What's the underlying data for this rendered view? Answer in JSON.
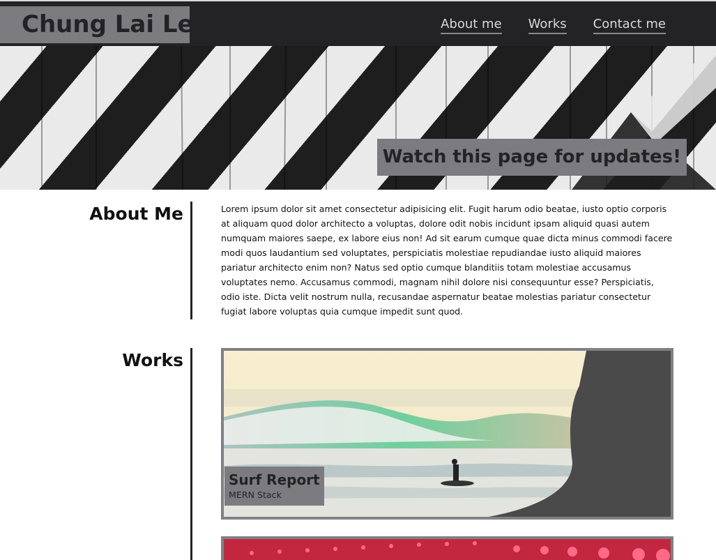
{
  "header": {
    "brand": "Chung Lai Lee",
    "nav": [
      {
        "label": "About me"
      },
      {
        "label": "Works"
      },
      {
        "label": "Contact me"
      }
    ]
  },
  "hero": {
    "banner": "Watch this page for updates!"
  },
  "about": {
    "heading": "About Me",
    "body": "Lorem ipsum dolor sit amet consectetur adipisicing elit. Fugit harum odio beatae, iusto optio corporis at aliquam quod dolor architecto a voluptas, dolore odit nobis incidunt ipsam aliquid quasi autem numquam maiores saepe, ex labore eius non! Ad sit earum cumque quae dicta minus commodi facere modi quos laudantium sed voluptates, perspiciatis molestiae repudiandae iusto aliquid maiores pariatur architecto enim non? Natus sed optio cumque blanditiis totam molestiae accusamus voluptates nemo. Accusamus commodi, magnam nihil dolore nisi consequuntur esse? Perspiciatis, odio iste. Dicta velit nostrum nulla, recusandae aspernatur beatae molestias pariatur consectetur fugiat labore voluptas quia cumque impedit sunt quod."
  },
  "works": {
    "heading": "Works",
    "items": [
      {
        "title": "Surf Report",
        "subtitle": "MERN Stack"
      }
    ]
  },
  "colors": {
    "header_bg": "#232325",
    "accent_gray": "#7c7b80",
    "text_dark": "#111111",
    "nav_text": "#d9d9d9"
  }
}
